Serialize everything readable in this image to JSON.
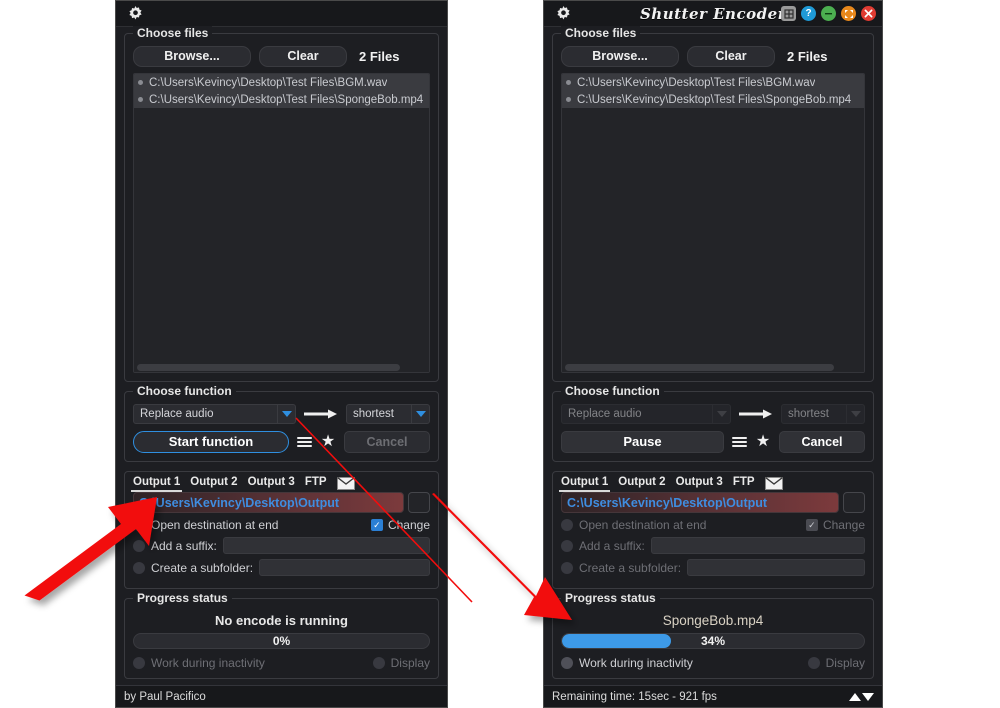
{
  "colors": {
    "accent_blue": "#2f8fe0",
    "progress_blue": "#3d9ae8",
    "path_red": "#7c3a3c",
    "annotation_red": "#f20d0d",
    "close_red": "#e03b32",
    "minimize_green": "#4caf50",
    "maximize_orange": "#e8881c",
    "help_blue": "#1f9ad6"
  },
  "left": {
    "titlebar": {
      "gear_icon": "gear-icon",
      "title": ""
    },
    "files": {
      "legend": "Choose files",
      "browse_label": "Browse...",
      "clear_label": "Clear",
      "count_label": "2 Files",
      "items": [
        "C:\\Users\\Kevincy\\Desktop\\Test Files\\BGM.wav",
        "C:\\Users\\Kevincy\\Desktop\\Test Files\\SpongeBob.mp4"
      ]
    },
    "function": {
      "legend": "Choose function",
      "selected": "Replace audio",
      "mode": "shortest",
      "start_label": "Start function",
      "menu_icon": "hamburger-menu-icon",
      "favorite_icon": "star-icon",
      "cancel_label": "Cancel"
    },
    "output": {
      "tabs": [
        "Output 1",
        "Output 2",
        "Output 3",
        "FTP"
      ],
      "selected_tab": "Output 1",
      "mail_icon": "mail-icon",
      "path": "C:\\Users\\Kevincy\\Desktop\\Output",
      "open_dest_label": "Open destination at end",
      "change_label": "Change",
      "suffix_label": "Add a suffix:",
      "suffix_value": "",
      "subfolder_label": "Create a subfolder:",
      "subfolder_value": ""
    },
    "progress": {
      "legend": "Progress status",
      "title": "No encode is running",
      "percent_label": "0%",
      "percent": 0,
      "inactivity_label": "Work during inactivity",
      "display_label": "Display"
    },
    "status": {
      "text": "by Paul Pacifico"
    }
  },
  "right": {
    "titlebar": {
      "gear_icon": "gear-icon",
      "title": "Shutter Encoder",
      "buttons": [
        "grid-icon",
        "help-icon",
        "minimize-icon",
        "maximize-icon",
        "close-icon"
      ]
    },
    "files": {
      "legend": "Choose files",
      "browse_label": "Browse...",
      "clear_label": "Clear",
      "count_label": "2 Files",
      "items": [
        "C:\\Users\\Kevincy\\Desktop\\Test Files\\BGM.wav",
        "C:\\Users\\Kevincy\\Desktop\\Test Files\\SpongeBob.mp4"
      ]
    },
    "function": {
      "legend": "Choose function",
      "selected": "Replace audio",
      "mode": "shortest",
      "start_label": "Pause",
      "menu_icon": "hamburger-menu-icon",
      "favorite_icon": "star-icon",
      "cancel_label": "Cancel"
    },
    "output": {
      "tabs": [
        "Output 1",
        "Output 2",
        "Output 3",
        "FTP"
      ],
      "selected_tab": "Output 1",
      "mail_icon": "mail-icon",
      "path": "C:\\Users\\Kevincy\\Desktop\\Output",
      "open_dest_label": "Open destination at end",
      "change_label": "Change",
      "suffix_label": "Add a suffix:",
      "suffix_value": "",
      "subfolder_label": "Create a subfolder:",
      "subfolder_value": ""
    },
    "progress": {
      "legend": "Progress status",
      "title": "SpongeBob.mp4",
      "percent_label": "34%",
      "percent": 34,
      "inactivity_label": "Work during inactivity",
      "display_label": "Display"
    },
    "status": {
      "text": "Remaining time: 15sec - 921 fps",
      "up_icon": "triangle-up-icon",
      "down_icon": "triangle-down-icon"
    }
  }
}
